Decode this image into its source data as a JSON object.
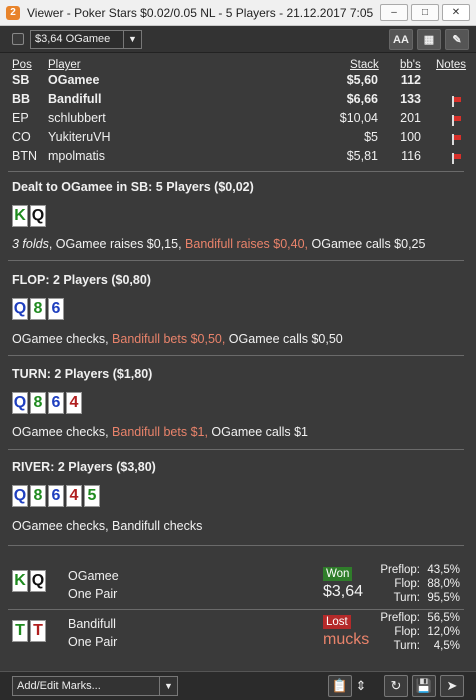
{
  "window": {
    "title": "Viewer - Poker Stars $0.02/0.05 NL - 5 Players - 21.12.2017 7:05",
    "app_icon": "2",
    "min": "–",
    "max": "□",
    "close": "✕"
  },
  "toolbar": {
    "player_select": "$3,64 OGamee",
    "font_button": "AA",
    "grid_icon": "▦",
    "edit_icon": "✎"
  },
  "table": {
    "headers": {
      "pos": "Pos",
      "player": "Player",
      "stack": "Stack",
      "bbs": "bb's",
      "notes": "Notes"
    },
    "rows": [
      {
        "pos": "SB",
        "player": "OGamee",
        "stack": "$5,60",
        "bbs": "112"
      },
      {
        "pos": "BB",
        "player": "Bandifull",
        "stack": "$6,66",
        "bbs": "133"
      },
      {
        "pos": "EP",
        "player": "schlubbert",
        "stack": "$10,04",
        "bbs": "201"
      },
      {
        "pos": "CO",
        "player": "YukiteruVH",
        "stack": "$5",
        "bbs": "100"
      },
      {
        "pos": "BTN",
        "player": "mpolmatis",
        "stack": "$5,81",
        "bbs": "116"
      }
    ]
  },
  "preflop": {
    "title": "Dealt to OGamee in SB: 5 Players ($0,02)",
    "cards": [
      {
        "rank": "K",
        "color": "#1f8a1f"
      },
      {
        "rank": "Q",
        "color": "#111111"
      }
    ],
    "a1": "3 folds",
    "a2": ", OGamee raises $0,15, ",
    "a3": "Bandifull raises $0,40,",
    "a4": " OGamee calls $0,25"
  },
  "flop": {
    "title": "FLOP: 2 Players ($0,80)",
    "cards": [
      {
        "rank": "Q",
        "color": "#1f3fbf"
      },
      {
        "rank": "8",
        "color": "#1f8a1f"
      },
      {
        "rank": "6",
        "color": "#1f3fbf"
      }
    ],
    "a1": "OGamee checks, ",
    "a2": "Bandifull bets $0,50,",
    "a3": " OGamee calls $0,50"
  },
  "turn": {
    "title": "TURN: 2 Players ($1,80)",
    "cards": [
      {
        "rank": "Q",
        "color": "#1f3fbf"
      },
      {
        "rank": "8",
        "color": "#1f8a1f"
      },
      {
        "rank": "6",
        "color": "#1f3fbf"
      },
      {
        "rank": "4",
        "color": "#b01e1e"
      }
    ],
    "a1": "OGamee checks, ",
    "a2": "Bandifull bets $1,",
    "a3": " OGamee calls $1"
  },
  "river": {
    "title": "RIVER: 2 Players ($3,80)",
    "cards": [
      {
        "rank": "Q",
        "color": "#1f3fbf"
      },
      {
        "rank": "8",
        "color": "#1f8a1f"
      },
      {
        "rank": "6",
        "color": "#1f3fbf"
      },
      {
        "rank": "4",
        "color": "#b01e1e"
      },
      {
        "rank": "5",
        "color": "#1f8a1f"
      }
    ],
    "a1": "OGamee checks, Bandifull checks"
  },
  "results": [
    {
      "cards": [
        {
          "rank": "K",
          "color": "#1f8a1f"
        },
        {
          "rank": "Q",
          "color": "#111111"
        }
      ],
      "name": "OGamee",
      "hand": "One Pair",
      "badge": "Won",
      "amount": "$3,64",
      "stats": [
        {
          "label": "Preflop:",
          "value": "43,5%"
        },
        {
          "label": "Flop:",
          "value": "88,0%"
        },
        {
          "label": "Turn:",
          "value": "95,5%"
        }
      ]
    },
    {
      "cards": [
        {
          "rank": "T",
          "color": "#1f8a1f"
        },
        {
          "rank": "T",
          "color": "#b01e1e"
        }
      ],
      "name": "Bandifull",
      "hand": "One Pair",
      "badge": "Lost",
      "amount": "mucks",
      "stats": [
        {
          "label": "Preflop:",
          "value": "56,5%"
        },
        {
          "label": "Flop:",
          "value": "12,0%"
        },
        {
          "label": "Turn:",
          "value": "4,5%"
        }
      ]
    }
  ],
  "bottom": {
    "marks": "Add/Edit Marks...",
    "clipboard_icon": "📋",
    "updown_icon": "⇕",
    "refresh_icon": "↻",
    "save_icon": "💾",
    "share_icon": "➤"
  }
}
